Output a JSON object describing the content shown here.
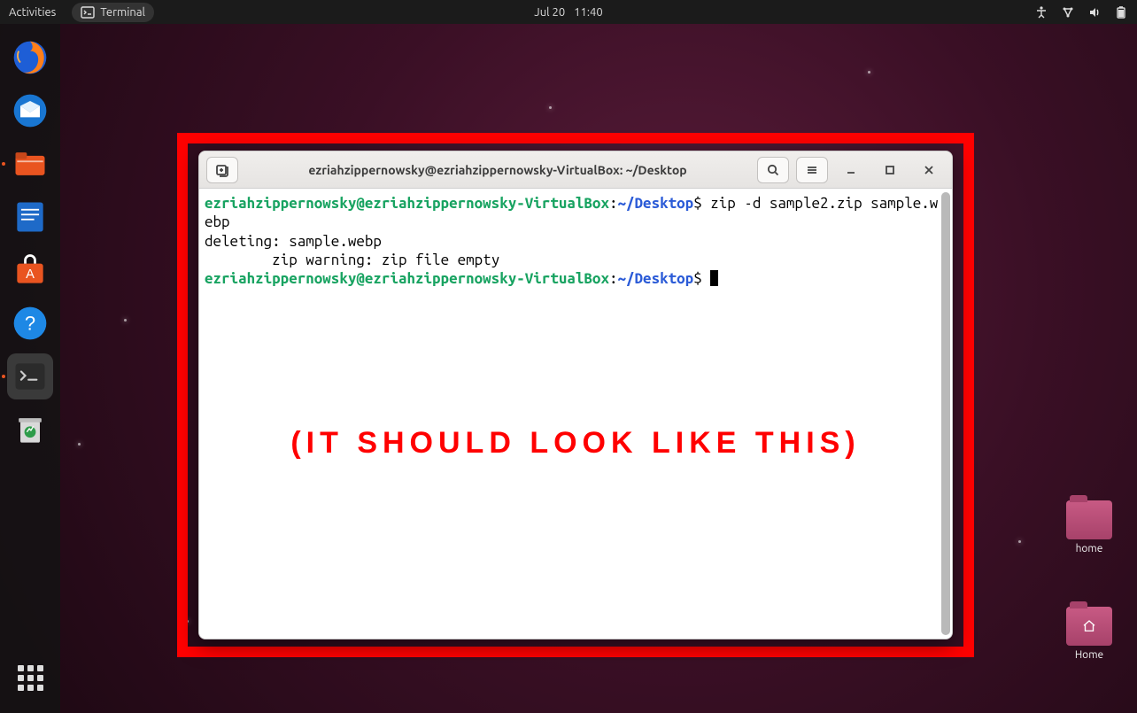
{
  "topbar": {
    "activities": "Activities",
    "app_label": "Terminal",
    "date": "Jul 20",
    "time": "11:40"
  },
  "dock": {
    "items": [
      {
        "name": "firefox"
      },
      {
        "name": "thunderbird"
      },
      {
        "name": "files"
      },
      {
        "name": "libreoffice-writer"
      },
      {
        "name": "software"
      },
      {
        "name": "help"
      },
      {
        "name": "terminal"
      },
      {
        "name": "trash"
      }
    ]
  },
  "desktop": {
    "icons": [
      {
        "label": "home"
      },
      {
        "label": "Home"
      }
    ]
  },
  "terminal": {
    "title": "ezriahzippernowsky@ezriahzippernowsky-VirtualBox: ~/Desktop",
    "prompt_user": "ezriahzippernowsky@ezriahzippernowsky-VirtualBox",
    "prompt_path": "~/Desktop",
    "command": "zip -d sample2.zip sample.webp",
    "output_line1": "deleting: sample.webp",
    "output_line2": "        zip warning: zip file empty",
    "caption": "(IT SHOULD LOOK LIKE THIS)"
  },
  "colors": {
    "accent_red": "#ff0000",
    "prompt_green": "#18a361",
    "prompt_blue": "#2b5bd7"
  }
}
